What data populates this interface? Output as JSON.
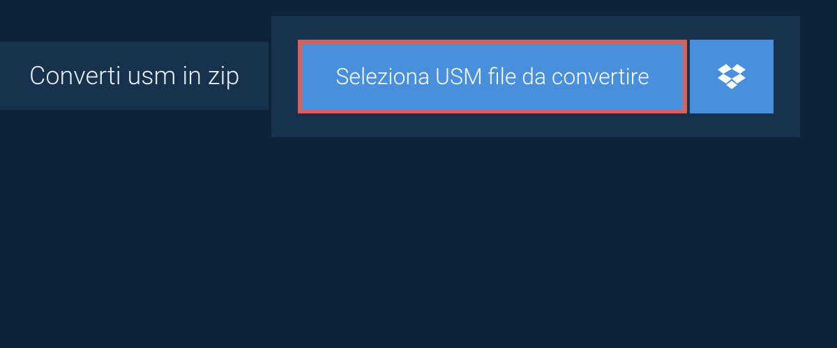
{
  "header": {
    "title": "Converti usm in zip"
  },
  "actions": {
    "select_file_label": "Seleziona USM file da convertire"
  }
}
